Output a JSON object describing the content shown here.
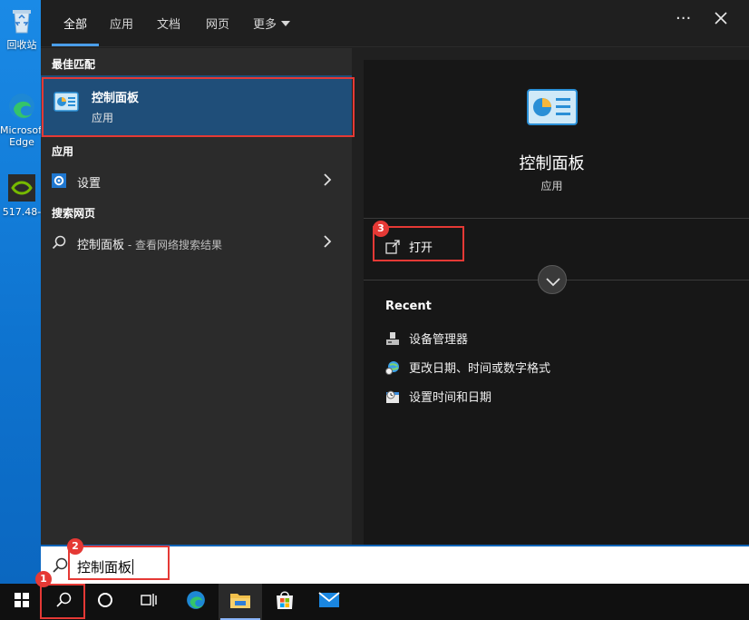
{
  "desktop": {
    "icons": [
      {
        "label": "回收站"
      },
      {
        "label": "Microsoft Edge"
      },
      {
        "label": "517.48-"
      }
    ]
  },
  "search_panel": {
    "tabs": [
      "全部",
      "应用",
      "文档",
      "网页",
      "更多"
    ],
    "active_tab": "全部",
    "more_icon": "ellipsis-icon",
    "close_icon": "close-icon",
    "best_match": {
      "section": "最佳匹配",
      "title": "控制面板",
      "subtitle": "应用"
    },
    "apps": {
      "section": "应用",
      "items": [
        {
          "label": "设置"
        }
      ]
    },
    "web": {
      "section": "搜索网页",
      "query": "控制面板",
      "hint": " - 查看网络搜索结果"
    },
    "detail": {
      "title": "控制面板",
      "type": "应用",
      "open_label": "打开",
      "recent_heading": "Recent",
      "recent": [
        "设备管理器",
        "更改日期、时间或数字格式",
        "设置时间和日期"
      ]
    }
  },
  "searchbox": {
    "value": "控制面板"
  },
  "annotations": [
    "1",
    "2",
    "3"
  ],
  "colors": {
    "accent": "#4a9eea",
    "highlight": "#1f4e79",
    "annotation": "#e53935"
  }
}
